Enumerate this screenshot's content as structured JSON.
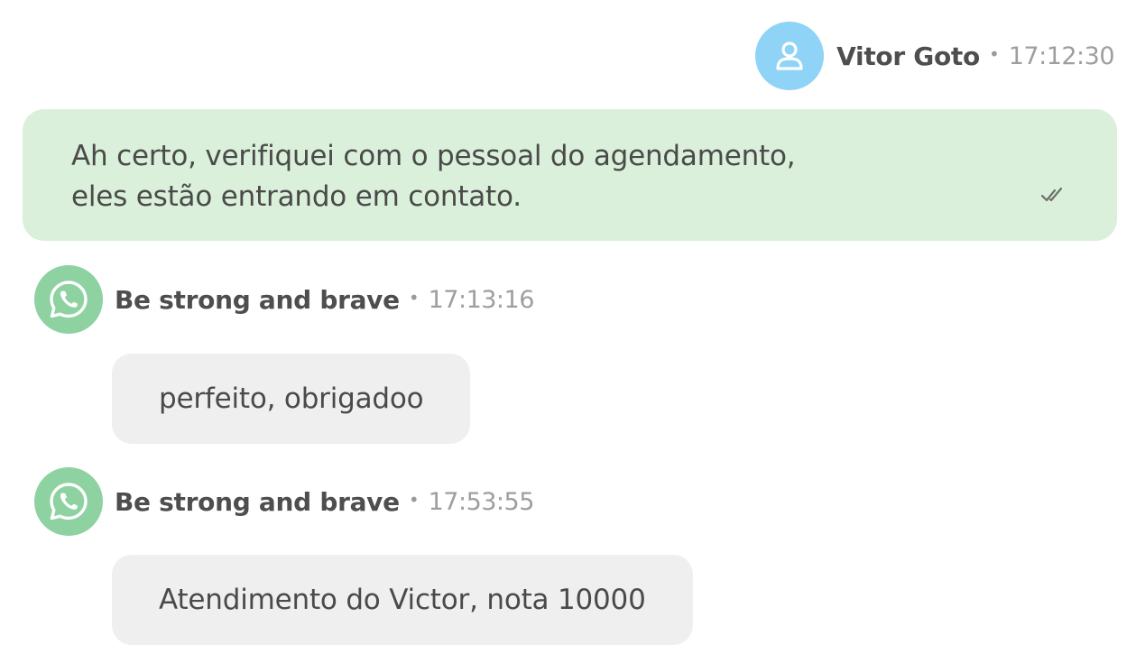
{
  "messages": [
    {
      "direction": "outgoing",
      "sender": "Vitor Goto",
      "separator": "•",
      "time": "17:12:30",
      "text": "Ah certo, verifiquei com o pessoal do agendamento,\neles estão entrando em contato.",
      "status_icon": "double-check-icon",
      "avatar_icon": "user-icon"
    },
    {
      "direction": "incoming",
      "sender": "Be strong and brave",
      "separator": "•",
      "time": "17:13:16",
      "text": "perfeito, obrigadoo",
      "avatar_icon": "whatsapp-icon"
    },
    {
      "direction": "incoming",
      "sender": "Be strong and brave",
      "separator": "•",
      "time": "17:53:55",
      "text": "Atendimento do Victor, nota 10000",
      "avatar_icon": "whatsapp-icon"
    }
  ],
  "colors": {
    "outgoing_bubble": "#daf0da",
    "incoming_bubble": "#efefef",
    "user_avatar": "#8fd3f7",
    "whatsapp_avatar": "#8ed2a2"
  }
}
